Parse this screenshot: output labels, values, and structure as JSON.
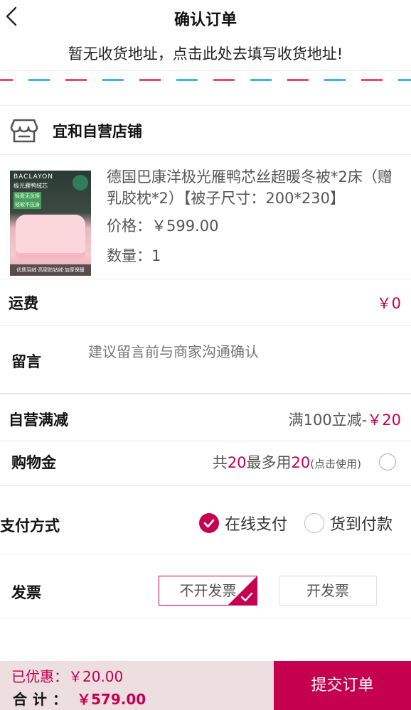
{
  "header": {
    "title": "确认订单"
  },
  "address": {
    "prompt": "暂无收货地址，点击此处去填写收货地址!"
  },
  "store": {
    "name": "宜和自营店铺"
  },
  "product": {
    "title": "德国巴康洋极光雁鸭芯丝超暖冬被*2床（赠乳胶枕*2）【被子尺寸：200*230】",
    "price": "价格：￥599.00",
    "quantity": "数量：1",
    "image_text": {
      "brand": "BACLAYON",
      "name": "极光雁鸭绒芯",
      "tag1": "轻盈无负担",
      "tag2": "轻软不压身",
      "footer": "优质羽绒·高密防钻绒·加厚保暖"
    }
  },
  "freight": {
    "label": "运费",
    "value": "￥0"
  },
  "message": {
    "label": "留言",
    "placeholder": "建议留言前与商家沟通确认"
  },
  "discount": {
    "label": "自营满减",
    "value_prefix": "满100立减-",
    "value_amount": "￥20"
  },
  "credit": {
    "label": "购物金",
    "text_1": "共",
    "total": "20",
    "text_2": "最多用",
    "usable": "20",
    "hint": "(点击使用)"
  },
  "payment": {
    "label": "支付方式",
    "options": [
      {
        "label": "在线支付",
        "selected": true
      },
      {
        "label": "货到付款",
        "selected": false
      }
    ]
  },
  "invoice": {
    "label": "发票",
    "options": [
      {
        "label": "不开发票",
        "selected": true
      },
      {
        "label": "开发票",
        "selected": false
      }
    ]
  },
  "summary": {
    "saved": "已优惠：￥20.00",
    "total_label": "合计：",
    "total_value": "￥579.00",
    "submit_label": "提交订单"
  },
  "colors": {
    "accent": "#c4004f",
    "bar_bg": "#eddfe1",
    "airmail_red": "#e84a5f",
    "airmail_blue": "#3cb4e5"
  },
  "icons": {
    "back": "chevron-left-icon",
    "store": "store-icon",
    "check": "check-icon"
  }
}
